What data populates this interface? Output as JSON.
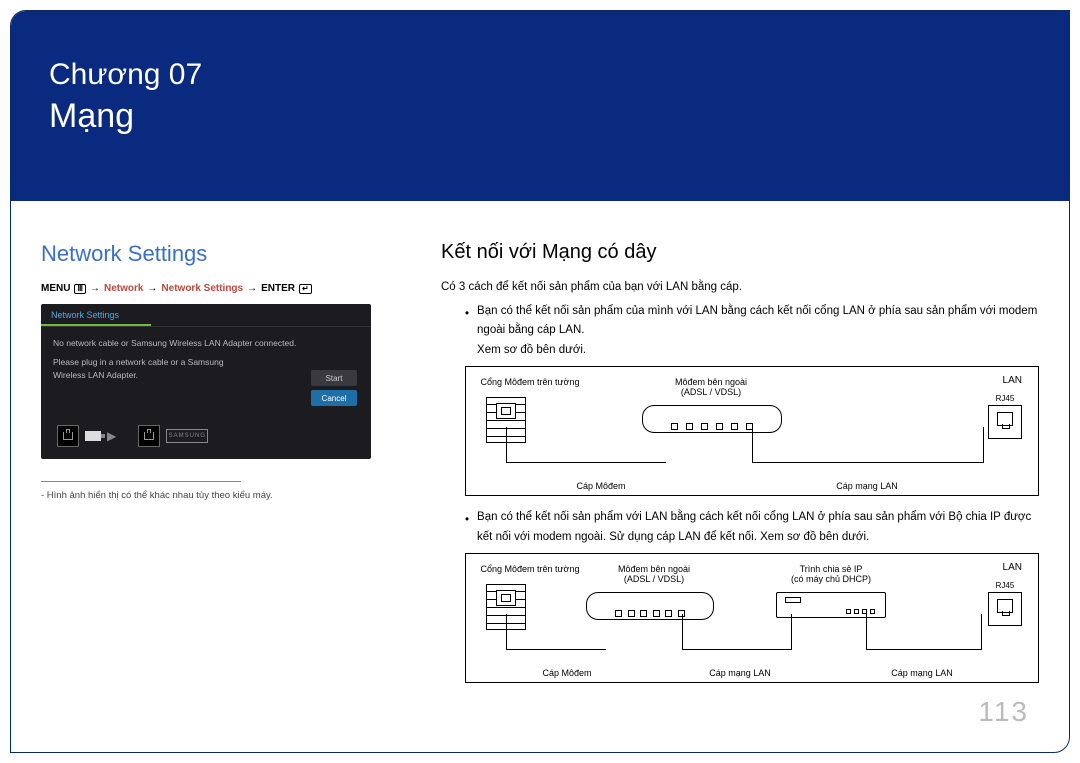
{
  "chapter": {
    "line": "Chương 07",
    "title": "Mạng"
  },
  "left": {
    "heading": "Network Settings",
    "breadcrumb": {
      "menu": "MENU",
      "network": "Network",
      "network_settings": "Network Settings",
      "enter": "ENTER"
    },
    "screenshot": {
      "title": "Network Settings",
      "line1": "No network cable or Samsung Wireless LAN Adapter connected.",
      "line2": "Please plug in a network cable or a Samsung Wireless LAN Adapter.",
      "btn_start": "Start",
      "btn_cancel": "Cancel",
      "logo": "SAMSUNG"
    },
    "footnote": "- Hình ảnh hiển thị có thể khác nhau tùy theo kiểu máy."
  },
  "right": {
    "heading": "Kết nối với Mạng có dây",
    "intro": "Có 3 cách để kết nối sản phẩm của bạn với LAN bằng cáp.",
    "bullet1": "Bạn có thể kết nối sản phẩm của mình với LAN bằng cách kết nối cổng LAN ở phía sau sản phẩm với modem ngoài bằng cáp LAN.",
    "see_below": "Xem sơ đồ bên dưới.",
    "bullet2": "Bạn có thể kết nối sản phẩm với LAN bằng cách kết nối cổng LAN ở phía sau sản phẩm với Bộ chia IP được kết nối với modem ngoài. Sử dụng cáp LAN để kết nối. Xem sơ đồ bên dưới.",
    "diagram_labels": {
      "wall_port": "Cổng Môđem trên tường",
      "modem": "Môđem bên ngoài",
      "modem_sub": "(ADSL / VDSL)",
      "ip_sharer": "Trình chia sẻ IP",
      "ip_sharer_sub": "(có máy chủ DHCP)",
      "lan": "LAN",
      "rj45": "RJ45",
      "cable_modem": "Cáp Môđem",
      "cable_lan": "Cáp mạng LAN"
    }
  },
  "page_number": "113"
}
